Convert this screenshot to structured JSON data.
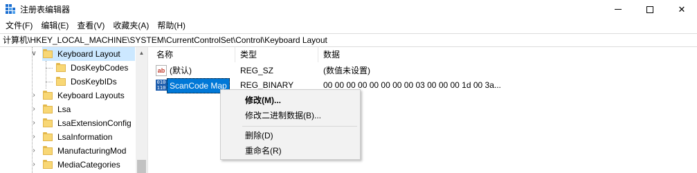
{
  "window": {
    "title": "注册表编辑器",
    "icon": "registry-editor-icon",
    "controls": {
      "minimize": "minimize-icon",
      "maximize": "maximize-icon",
      "close": "✕"
    }
  },
  "menu": [
    "文件(F)",
    "编辑(E)",
    "查看(V)",
    "收藏夹(A)",
    "帮助(H)"
  ],
  "address": "计算机\\HKEY_LOCAL_MACHINE\\SYSTEM\\CurrentControlSet\\Control\\Keyboard Layout",
  "tree": {
    "items": [
      {
        "label": "Keyboard Layout",
        "expanded": true,
        "selected": true
      },
      {
        "label": "DosKeybCodes"
      },
      {
        "label": "DosKeybIDs"
      },
      {
        "label": "Keyboard Layouts"
      },
      {
        "label": "Lsa"
      },
      {
        "label": "LsaExtensionConfig"
      },
      {
        "label": "LsaInformation"
      },
      {
        "label": "ManufacturingMod"
      },
      {
        "label": "MediaCategories"
      }
    ],
    "expand_glyph": "∨",
    "collapse_glyph": "›",
    "scroll_up_glyph": "▲"
  },
  "columns": {
    "name": "名称",
    "type": "类型",
    "data": "数据"
  },
  "values": [
    {
      "icon": "ab",
      "name": "(默认)",
      "type": "REG_SZ",
      "data": "(数值未设置)"
    },
    {
      "icon": "010\n110",
      "name": "ScanCode Map",
      "type": "REG_BINARY",
      "data": "00 00 00 00 00 00 00 00 03 00 00 00 1d 00 3a..."
    }
  ],
  "context_menu": {
    "modify": "修改(M)...",
    "modify_binary": "修改二进制数据(B)...",
    "delete": "删除(D)",
    "rename": "重命名(R)"
  },
  "colors": {
    "selection": "#0078d7",
    "tree_selection": "#cce8ff",
    "folder": "#f8d775"
  }
}
